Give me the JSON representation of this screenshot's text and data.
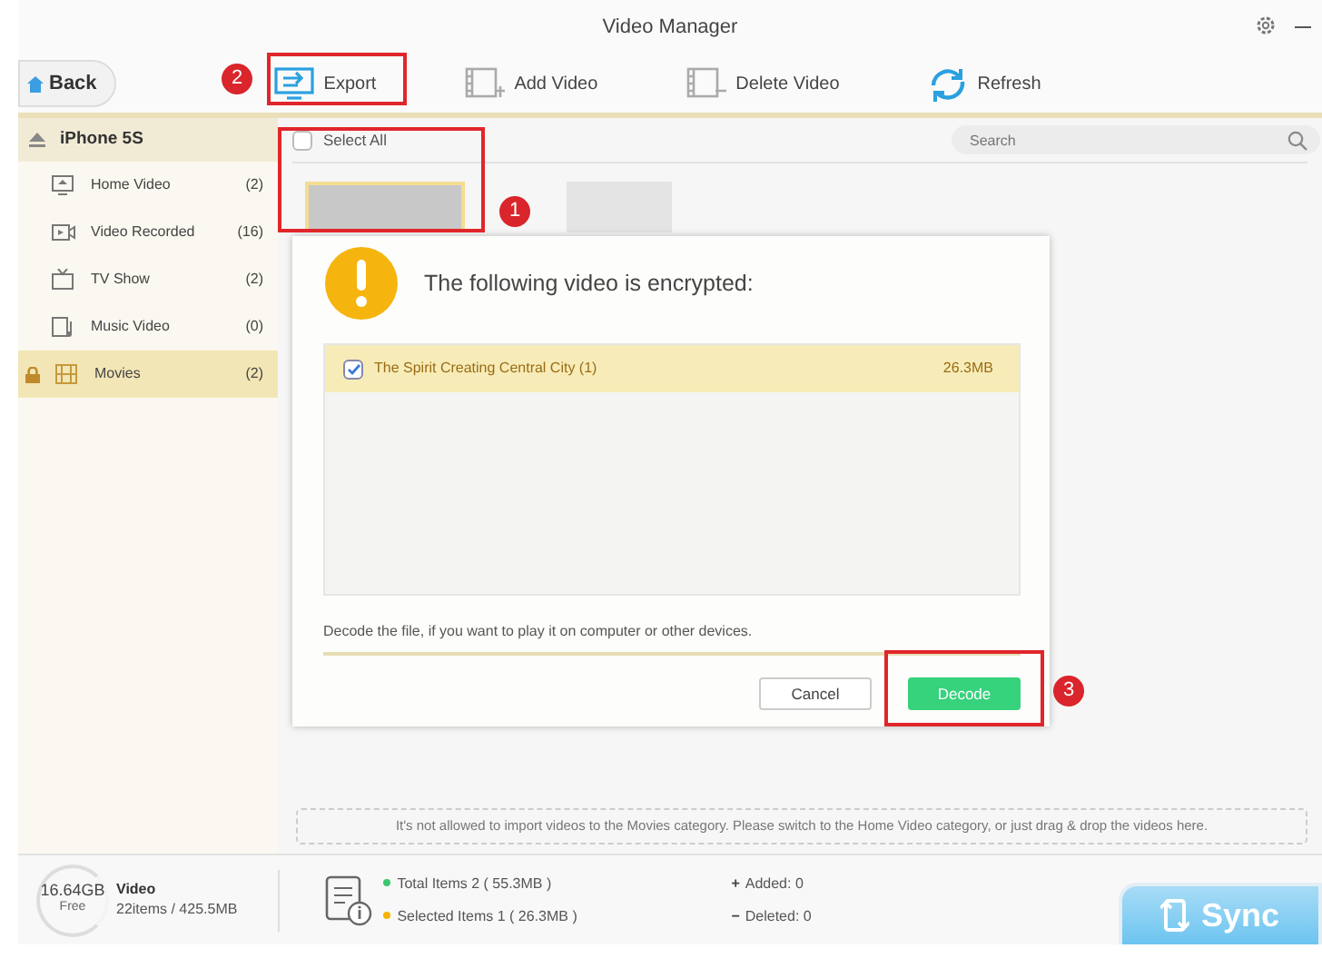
{
  "window": {
    "title": "Video Manager"
  },
  "toolbar": {
    "back": "Back",
    "buttons": [
      {
        "label": "Export",
        "kind": "export"
      },
      {
        "label": "Add Video",
        "kind": "add"
      },
      {
        "label": "Delete Video",
        "kind": "delete"
      },
      {
        "label": "Refresh",
        "kind": "refresh"
      }
    ]
  },
  "device": {
    "name": "iPhone 5S"
  },
  "sidebar": {
    "items": [
      {
        "label": "Home Video",
        "count": "(2)",
        "kind": "home",
        "selected": false,
        "locked": false
      },
      {
        "label": "Video Recorded",
        "count": "(16)",
        "kind": "camera",
        "selected": false,
        "locked": false
      },
      {
        "label": "TV Show",
        "count": "(2)",
        "kind": "tv",
        "selected": false,
        "locked": false
      },
      {
        "label": "Music Video",
        "count": "(0)",
        "kind": "music",
        "selected": false,
        "locked": false
      },
      {
        "label": "Movies",
        "count": "(2)",
        "kind": "film",
        "selected": true,
        "locked": true
      }
    ]
  },
  "content": {
    "select_all": {
      "label": "Select All",
      "checked": false
    },
    "search": {
      "placeholder": "Search"
    },
    "thumbnails": [
      {
        "selected": true
      },
      {
        "selected": false
      }
    ]
  },
  "dialog": {
    "title": "The following video is encrypted:",
    "files": [
      {
        "name": "The Spirit Creating Central City (1)",
        "size": "26.3MB",
        "checked": true
      }
    ],
    "hint": "Decode the file, if you want to play it on computer or other devices.",
    "buttons": [
      {
        "label": "Cancel",
        "kind": "secondary"
      },
      {
        "label": "Decode",
        "kind": "primary"
      }
    ]
  },
  "drop_notice": "It's not allowed to  import videos to the Movies category.  Please switch to the Home Video category, or just drag & drop the videos here.",
  "footer": {
    "storage": {
      "size": "16.64GB",
      "caption": "Free"
    },
    "category": "Video",
    "usage": "22items / 425.5MB",
    "stats": [
      {
        "text": "Total Items 2 ( 55.3MB )",
        "color": "#3cc86e"
      },
      {
        "text": "Selected Items 1 ( 26.3MB )",
        "color": "#f5b400"
      }
    ],
    "changes": [
      {
        "sign": "+",
        "text": "Added: 0"
      },
      {
        "sign": "−",
        "text": "Deleted: 0"
      }
    ],
    "sync": "Sync"
  },
  "annotations": [
    {
      "number": "1"
    },
    {
      "number": "2"
    },
    {
      "number": "3"
    }
  ]
}
